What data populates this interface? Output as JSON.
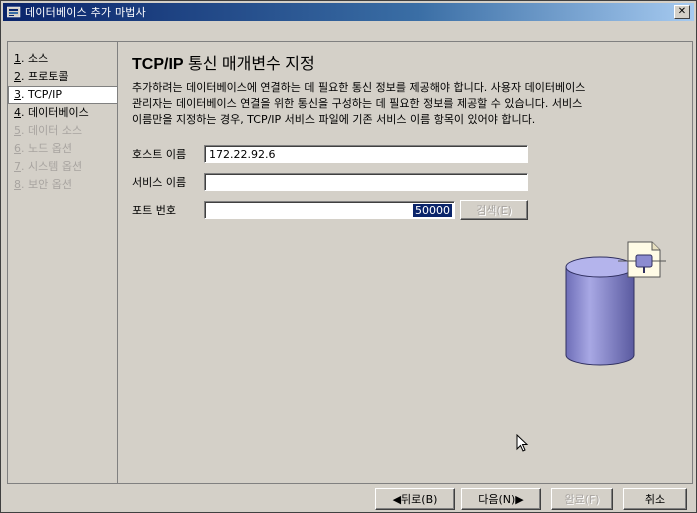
{
  "window": {
    "title": "데이터베이스 추가 마법사",
    "close_glyph": "✕",
    "app_icon": "database-wizard-icon"
  },
  "steps": [
    {
      "num": "1",
      "label": ". 소스",
      "state": "done"
    },
    {
      "num": "2",
      "label": ". 프로토콜",
      "state": "done"
    },
    {
      "num": "3",
      "label": ". TCP/IP",
      "state": "current"
    },
    {
      "num": "4",
      "label": ". 데이터베이스",
      "state": "done"
    },
    {
      "num": "5",
      "label": ". 데이터 소스",
      "state": "disabled"
    },
    {
      "num": "6",
      "label": ". 노드 옵션",
      "state": "disabled"
    },
    {
      "num": "7",
      "label": ". 시스템 옵션",
      "state": "disabled"
    },
    {
      "num": "8",
      "label": ". 보안 옵션",
      "state": "disabled"
    }
  ],
  "page": {
    "heading_bold": "TCP/IP",
    "heading_rest": " 통신 매개변수 지정",
    "description_lines": [
      "추가하려는 데이터베이스에 연결하는 데 필요한 통신 정보를 제공해야 합니다. 사용자 데이터베이스",
      "관리자는 데이터베이스 연결을 위한 통신을 구성하는 데 필요한 정보를 제공할 수 있습니다. 서비스",
      "이름만을 지정하는 경우, TCP/IP 서비스 파일에 기존 서비스 이름 항목이 있어야 합니다."
    ]
  },
  "form": {
    "host_label": "호스트 이름",
    "host_value": "172.22.92.6",
    "service_label": "서비스 이름",
    "service_value": "",
    "port_label": "포트 번호",
    "port_value": "50000",
    "browse_label": "검색(E)"
  },
  "buttons": {
    "back": "◀뒤로(B)",
    "next": "다음(N)▶",
    "finish": "완료(F)",
    "cancel": "취소"
  },
  "colors": {
    "title_start": "#0a246a",
    "title_end": "#a6caf0",
    "cylinder": "#8c8cd0",
    "selection": "#0a246a"
  },
  "icons": [
    "database-cylinder-icon",
    "document-icon",
    "mouse-cursor-icon"
  ]
}
